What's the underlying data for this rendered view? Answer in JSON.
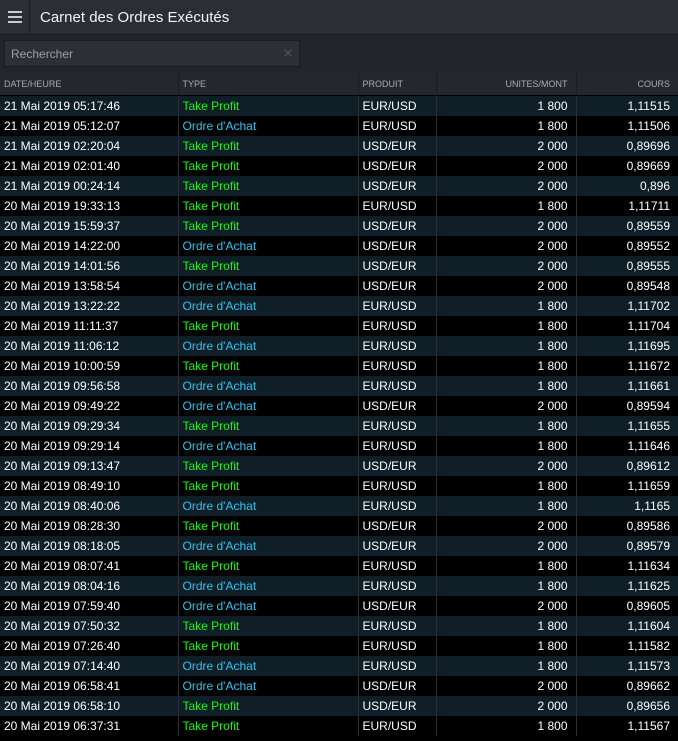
{
  "window": {
    "title": "Carnet des Ordres Exécutés"
  },
  "search": {
    "placeholder": "Rechercher",
    "clear_glyph": "✕"
  },
  "icons": {
    "menu": "hamburger-menu-icon",
    "clear": "close-icon"
  },
  "colors": {
    "take_profit": "#1cf21c",
    "ordre_achat": "#29c6f0"
  },
  "table": {
    "headers": {
      "date": "DATE/HEURE",
      "type": "TYPE",
      "product": "PRODUIT",
      "units": "UNITES/MONT",
      "price": "COURS"
    },
    "rows": [
      {
        "date": "21 Mai 2019 05:17:46",
        "type": "Take Profit",
        "product": "EUR/USD",
        "units": "1 800",
        "price": "1,11515"
      },
      {
        "date": "21 Mai 2019 05:12:07",
        "type": "Ordre d'Achat",
        "product": "EUR/USD",
        "units": "1 800",
        "price": "1,11506"
      },
      {
        "date": "21 Mai 2019 02:20:04",
        "type": "Take Profit",
        "product": "USD/EUR",
        "units": "2 000",
        "price": "0,89696"
      },
      {
        "date": "21 Mai 2019 02:01:40",
        "type": "Take Profit",
        "product": "USD/EUR",
        "units": "2 000",
        "price": "0,89669"
      },
      {
        "date": "21 Mai 2019 00:24:14",
        "type": "Take Profit",
        "product": "USD/EUR",
        "units": "2 000",
        "price": "0,896"
      },
      {
        "date": "20 Mai 2019 19:33:13",
        "type": "Take Profit",
        "product": "EUR/USD",
        "units": "1 800",
        "price": "1,11711"
      },
      {
        "date": "20 Mai 2019 15:59:37",
        "type": "Take Profit",
        "product": "USD/EUR",
        "units": "2 000",
        "price": "0,89559"
      },
      {
        "date": "20 Mai 2019 14:22:00",
        "type": "Ordre d'Achat",
        "product": "USD/EUR",
        "units": "2 000",
        "price": "0,89552"
      },
      {
        "date": "20 Mai 2019 14:01:56",
        "type": "Take Profit",
        "product": "USD/EUR",
        "units": "2 000",
        "price": "0,89555"
      },
      {
        "date": "20 Mai 2019 13:58:54",
        "type": "Ordre d'Achat",
        "product": "USD/EUR",
        "units": "2 000",
        "price": "0,89548"
      },
      {
        "date": "20 Mai 2019 13:22:22",
        "type": "Ordre d'Achat",
        "product": "EUR/USD",
        "units": "1 800",
        "price": "1,11702"
      },
      {
        "date": "20 Mai 2019 11:11:37",
        "type": "Take Profit",
        "product": "EUR/USD",
        "units": "1 800",
        "price": "1,11704"
      },
      {
        "date": "20 Mai 2019 11:06:12",
        "type": "Ordre d'Achat",
        "product": "EUR/USD",
        "units": "1 800",
        "price": "1,11695"
      },
      {
        "date": "20 Mai 2019 10:00:59",
        "type": "Take Profit",
        "product": "EUR/USD",
        "units": "1 800",
        "price": "1,11672"
      },
      {
        "date": "20 Mai 2019 09:56:58",
        "type": "Ordre d'Achat",
        "product": "EUR/USD",
        "units": "1 800",
        "price": "1,11661"
      },
      {
        "date": "20 Mai 2019 09:49:22",
        "type": "Ordre d'Achat",
        "product": "USD/EUR",
        "units": "2 000",
        "price": "0,89594"
      },
      {
        "date": "20 Mai 2019 09:29:34",
        "type": "Take Profit",
        "product": "EUR/USD",
        "units": "1 800",
        "price": "1,11655"
      },
      {
        "date": "20 Mai 2019 09:29:14",
        "type": "Ordre d'Achat",
        "product": "EUR/USD",
        "units": "1 800",
        "price": "1,11646"
      },
      {
        "date": "20 Mai 2019 09:13:47",
        "type": "Take Profit",
        "product": "USD/EUR",
        "units": "2 000",
        "price": "0,89612"
      },
      {
        "date": "20 Mai 2019 08:49:10",
        "type": "Take Profit",
        "product": "EUR/USD",
        "units": "1 800",
        "price": "1,11659"
      },
      {
        "date": "20 Mai 2019 08:40:06",
        "type": "Ordre d'Achat",
        "product": "EUR/USD",
        "units": "1 800",
        "price": "1,1165"
      },
      {
        "date": "20 Mai 2019 08:28:30",
        "type": "Take Profit",
        "product": "USD/EUR",
        "units": "2 000",
        "price": "0,89586"
      },
      {
        "date": "20 Mai 2019 08:18:05",
        "type": "Ordre d'Achat",
        "product": "USD/EUR",
        "units": "2 000",
        "price": "0,89579"
      },
      {
        "date": "20 Mai 2019 08:07:41",
        "type": "Take Profit",
        "product": "EUR/USD",
        "units": "1 800",
        "price": "1,11634"
      },
      {
        "date": "20 Mai 2019 08:04:16",
        "type": "Ordre d'Achat",
        "product": "EUR/USD",
        "units": "1 800",
        "price": "1,11625"
      },
      {
        "date": "20 Mai 2019 07:59:40",
        "type": "Ordre d'Achat",
        "product": "USD/EUR",
        "units": "2 000",
        "price": "0,89605"
      },
      {
        "date": "20 Mai 2019 07:50:32",
        "type": "Take Profit",
        "product": "EUR/USD",
        "units": "1 800",
        "price": "1,11604"
      },
      {
        "date": "20 Mai 2019 07:26:40",
        "type": "Take Profit",
        "product": "EUR/USD",
        "units": "1 800",
        "price": "1,11582"
      },
      {
        "date": "20 Mai 2019 07:14:40",
        "type": "Ordre d'Achat",
        "product": "EUR/USD",
        "units": "1 800",
        "price": "1,11573"
      },
      {
        "date": "20 Mai 2019 06:58:41",
        "type": "Ordre d'Achat",
        "product": "USD/EUR",
        "units": "2 000",
        "price": "0,89662"
      },
      {
        "date": "20 Mai 2019 06:58:10",
        "type": "Take Profit",
        "product": "USD/EUR",
        "units": "2 000",
        "price": "0,89656"
      },
      {
        "date": "20 Mai 2019 06:37:31",
        "type": "Take Profit",
        "product": "EUR/USD",
        "units": "1 800",
        "price": "1,11567"
      }
    ]
  }
}
